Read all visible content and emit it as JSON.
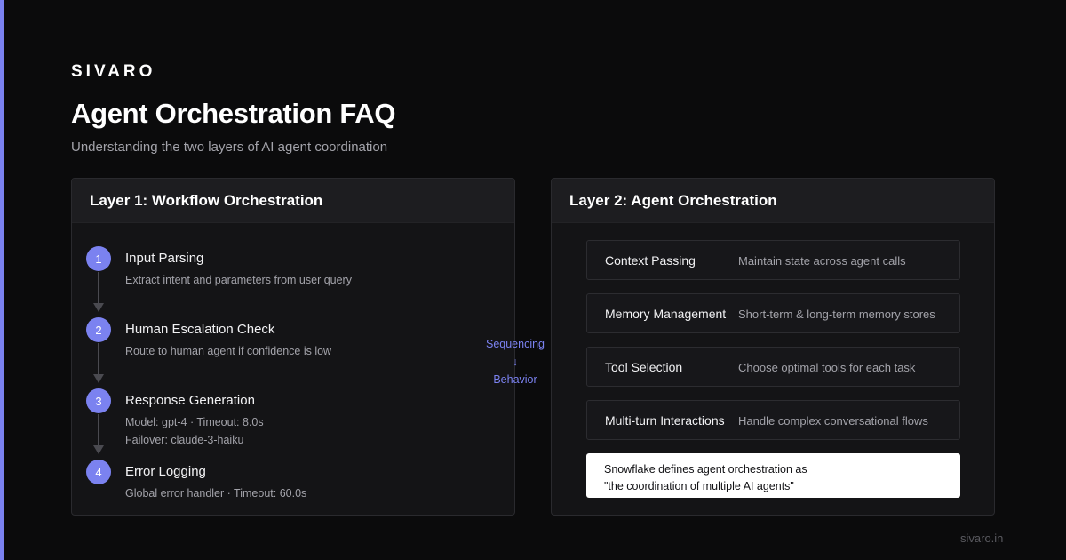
{
  "brand": "SIVARO",
  "title": "Agent Orchestration FAQ",
  "subtitle": "Understanding the two layers of AI agent coordination",
  "layer1": {
    "header": "Layer 1: Workflow Orchestration",
    "steps": [
      {
        "num": "1",
        "title": "Input Parsing",
        "lines": [
          "Extract intent and parameters from user query"
        ]
      },
      {
        "num": "2",
        "title": "Human Escalation Check",
        "lines": [
          "Route to human agent if confidence is low"
        ]
      },
      {
        "num": "3",
        "title": "Response Generation",
        "lines": [
          "Model: gpt-4 · Timeout: 8.0s",
          "Failover: claude-3-haiku"
        ]
      },
      {
        "num": "4",
        "title": "Error Logging",
        "lines": [
          "Global error handler · Timeout: 60.0s"
        ]
      }
    ]
  },
  "bridge": {
    "top": "Sequencing",
    "arrow": "↓",
    "bottom": "Behavior"
  },
  "layer2": {
    "header": "Layer 2: Agent Orchestration",
    "features": [
      {
        "name": "Context Passing",
        "desc": "Maintain state across agent calls"
      },
      {
        "name": "Memory Management",
        "desc": "Short-term & long-term memory stores"
      },
      {
        "name": "Tool Selection",
        "desc": "Choose optimal tools for each task"
      },
      {
        "name": "Multi-turn Interactions",
        "desc": "Handle complex conversational flows"
      }
    ],
    "quote": [
      "Snowflake defines agent orchestration as",
      "\"the coordination of multiple AI agents\""
    ]
  },
  "footer": "sivaro.in",
  "colors": {
    "accent": "#7b82f0",
    "background": "#0b0b0c",
    "card": "#141416"
  }
}
